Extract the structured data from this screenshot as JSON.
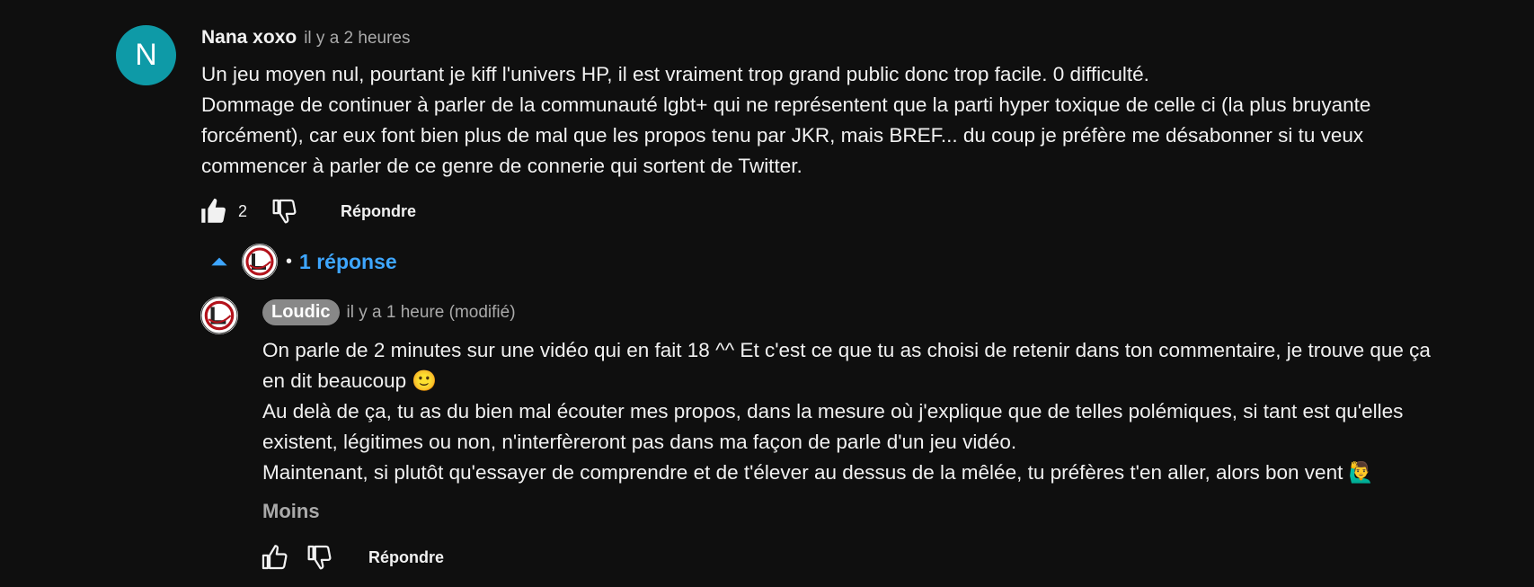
{
  "comment": {
    "avatar_letter": "N",
    "author": "Nana xoxo",
    "time": "il y a 2 heures",
    "lines": [
      "Un jeu moyen nul, pourtant je kiff l'univers HP, il est vraiment trop grand public donc trop facile. 0 difficulté.",
      "Dommage de continuer à parler de la communauté lgbt+ qui ne représentent que la parti hyper toxique de celle ci (la plus bruyante",
      "forcément), car eux font bien plus de mal que les propos tenu par JKR, mais BREF... du coup je préfère me désabonner si tu veux",
      "commencer à parler de ce genre de connerie qui sortent de Twitter."
    ],
    "like_count": "2",
    "reply_label": "Répondre"
  },
  "replies_toggle": {
    "separator": "•",
    "label": "1 réponse"
  },
  "reply": {
    "author": "Loudic",
    "time": "il y a 1 heure (modifié)",
    "lines": [
      "On parle de 2 minutes sur une vidéo qui en fait 18 ^^ Et c'est ce que tu as choisi de retenir dans ton commentaire, je trouve que ça",
      "en dit beaucoup 🙂",
      "Au delà de ça, tu as du bien mal écouter mes propos, dans la mesure où j'explique que de telles polémiques, si tant est qu'elles",
      "existent, légitimes ou non, n'interfèreront pas dans ma façon de parle d'un jeu vidéo.",
      "Maintenant, si plutôt qu'essayer de comprendre et de t'élever au dessus de la mêlée, tu préfères t'en aller, alors bon vent 🙋‍♂️"
    ],
    "less_label": "Moins",
    "reply_label": "Répondre"
  },
  "colors": {
    "background": "#0f0f0f",
    "avatar_teal": "#0e9aa7",
    "link_blue": "#3ea6ff",
    "author_chip": "#888888"
  }
}
